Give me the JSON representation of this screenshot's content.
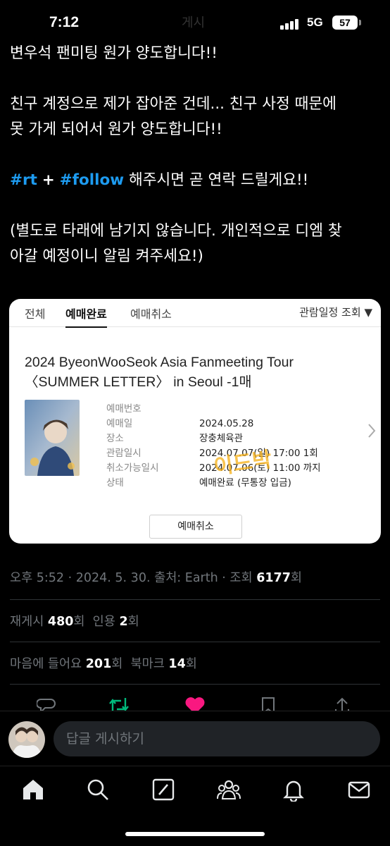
{
  "status_bar": {
    "time": "7:12",
    "network": "5G",
    "battery": "57",
    "ghost_title": "게시"
  },
  "tweet": {
    "line1": "변우석 팬미팅 원가 양도합니다!!",
    "line2": "친구 계정으로 제가 잡아준 건데... 친구 사정 때문에",
    "line3": "못 가게 되어서 원가 양도합니다!!",
    "hashtag1": "#rt",
    "plus": "+",
    "hashtag2": "#follow",
    "line4_rest": "해주시면 곧 연락 드릴게요!!",
    "line5": "(별도로 타래에 남기지 않습니다. 개인적으로 디엠 찾",
    "line6": "아갈 예정이니 알림 켜주세요!)"
  },
  "ticket": {
    "tabs": [
      "전체",
      "예매완료",
      "예매취소"
    ],
    "active_tab": "예매완료",
    "sort_label": "관람일정 조회",
    "title_line1": "2024 ByeonWooSeok Asia Fanmeeting Tour",
    "title_line2": "〈SUMMER LETTER〉 in Seoul -1매",
    "rows": [
      {
        "key": "예매번호",
        "value": ""
      },
      {
        "key": "예매일",
        "value": "2024.05.28"
      },
      {
        "key": "장소",
        "value": "장충체육관"
      },
      {
        "key": "관람일시",
        "value": "2024.07.07(일) 17:00 1회"
      },
      {
        "key": "취소가능일시",
        "value": "2024.07.06(토) 11:00 까지"
      },
      {
        "key": "상태",
        "value": "예매완료 (무통장 입금)"
      }
    ],
    "stamp": "이드박",
    "cancel_button": "예매취소"
  },
  "meta": {
    "time": "오후 5:52",
    "date": "2024. 5. 30.",
    "source_label": "출처: Earth",
    "views_label": "조회",
    "views": "6177",
    "views_suffix": "회"
  },
  "stats": {
    "reposts_label": "재게시",
    "reposts": "480",
    "reposts_suffix": "회",
    "quotes_label": "인용",
    "quotes": "2",
    "quotes_suffix": "회",
    "likes_label": "마음에 들어요",
    "likes": "201",
    "likes_suffix": "회",
    "bookmarks_label": "북마크",
    "bookmarks": "14",
    "bookmarks_suffix": "회"
  },
  "reply": {
    "placeholder": "답글 게시하기"
  },
  "colors": {
    "accent": "#1d9bf0",
    "like": "#f91880",
    "repost": "#00ba7c",
    "muted": "#71767b"
  },
  "nav_icons": [
    "home-icon",
    "search-icon",
    "grok-icon",
    "communities-icon",
    "notifications-icon",
    "messages-icon"
  ]
}
